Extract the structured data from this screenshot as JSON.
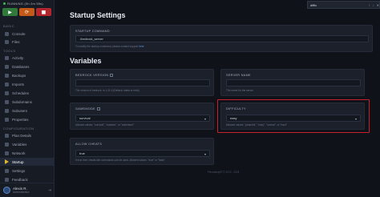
{
  "server_status": "RUNNING (0h 2m 59s)",
  "power": {
    "start": "▶",
    "restart": "⟳",
    "stop": "■"
  },
  "sidebar": {
    "sections": [
      {
        "title": "BASIC",
        "items": [
          {
            "label": "Console"
          },
          {
            "label": "Files"
          }
        ]
      },
      {
        "title": "TOOLS",
        "items": [
          {
            "label": "Activity"
          },
          {
            "label": "Databases"
          },
          {
            "label": "Backups"
          },
          {
            "label": "Imports"
          },
          {
            "label": "Schedules"
          },
          {
            "label": "Subdomains"
          },
          {
            "label": "Subusers"
          },
          {
            "label": "Properties"
          }
        ]
      },
      {
        "title": "CONFIGURATION",
        "items": [
          {
            "label": "Plan Details"
          },
          {
            "label": "Variables"
          },
          {
            "label": "Network"
          },
          {
            "label": "Startup"
          },
          {
            "label": "Settings"
          },
          {
            "label": "Feedback"
          }
        ]
      }
    ],
    "user": {
      "name": "Alexis R.",
      "role": "Administrator"
    }
  },
  "main": {
    "page_title": "Startup Settings",
    "startup_command": {
      "label": "STARTUP COMMAND",
      "value": "./bedrock_server",
      "help": "To modify the startup command, please contact support",
      "help_link": "here"
    },
    "vars_title": "Variables",
    "cards": [
      {
        "label": "BEDROCK VERSION",
        "value": "",
        "help": "The version of bedrock. Is 1.21.3 (Default: latest or beta)",
        "type": "input",
        "locked": true
      },
      {
        "label": "SERVER NAME",
        "value": "",
        "help": "The name for the server",
        "type": "input",
        "locked": false
      },
      {
        "label": "GAMEMODE",
        "value": "survival",
        "help": "Allowed values: \"survival\", \"creative\", or \"adventure\"",
        "type": "select",
        "locked": true
      },
      {
        "label": "DIFFICULTY",
        "value": "easy",
        "help": "Allowed values: \"peaceful\", \"easy\", \"normal\", or \"hard\"",
        "type": "select",
        "locked": false
      },
      {
        "label": "ALLOW CHEATS",
        "value": "true",
        "help": "If true then cheats like commands can be used. Allowed values: \"true\" or \"false\"",
        "type": "select",
        "locked": false
      }
    ],
    "footer": "Pterodactyl® © 2015 - 2024"
  },
  "find": {
    "query": "diffic",
    "prev": "↑",
    "next": "↓",
    "close": "✕"
  },
  "colors": {
    "highlight": "#c8202a",
    "active_icon": "#e0b72f",
    "link": "#5b9bf0"
  }
}
